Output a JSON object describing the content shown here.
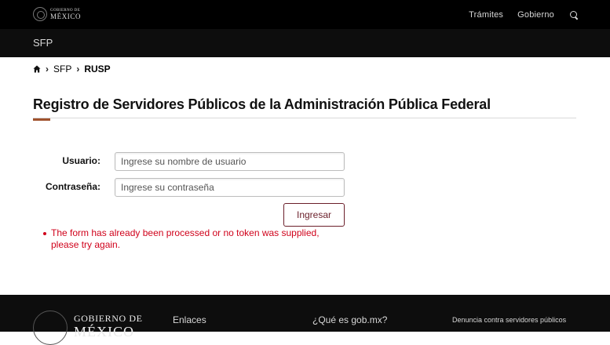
{
  "header": {
    "logo_line1": "GOBIERNO DE",
    "logo_line2": "MÉXICO",
    "nav": [
      "Trámites",
      "Gobierno"
    ]
  },
  "subheader": {
    "site": "SFP"
  },
  "breadcrumb": {
    "items": [
      "SFP",
      "RUSP"
    ]
  },
  "page": {
    "title": "Registro de Servidores Públicos de la Administración Pública Federal"
  },
  "form": {
    "user_label": "Usuario:",
    "user_placeholder": "Ingrese su nombre de usuario",
    "user_value": "",
    "pass_label": "Contraseña:",
    "pass_placeholder": "Ingrese su contraseña",
    "pass_value": "",
    "submit_label": "Ingresar",
    "error": "The form has already been processed or no token was supplied, please try again."
  },
  "footer": {
    "logo_line1": "GOBIERNO DE",
    "logo_line2": "MÉXICO",
    "links": [
      "Enlaces",
      "¿Qué es gob.mx?",
      "Denuncia contra servidores públicos"
    ]
  },
  "colors": {
    "accent": "#6b1f2a",
    "error": "#d0021b",
    "title_accent": "#a0522d"
  }
}
